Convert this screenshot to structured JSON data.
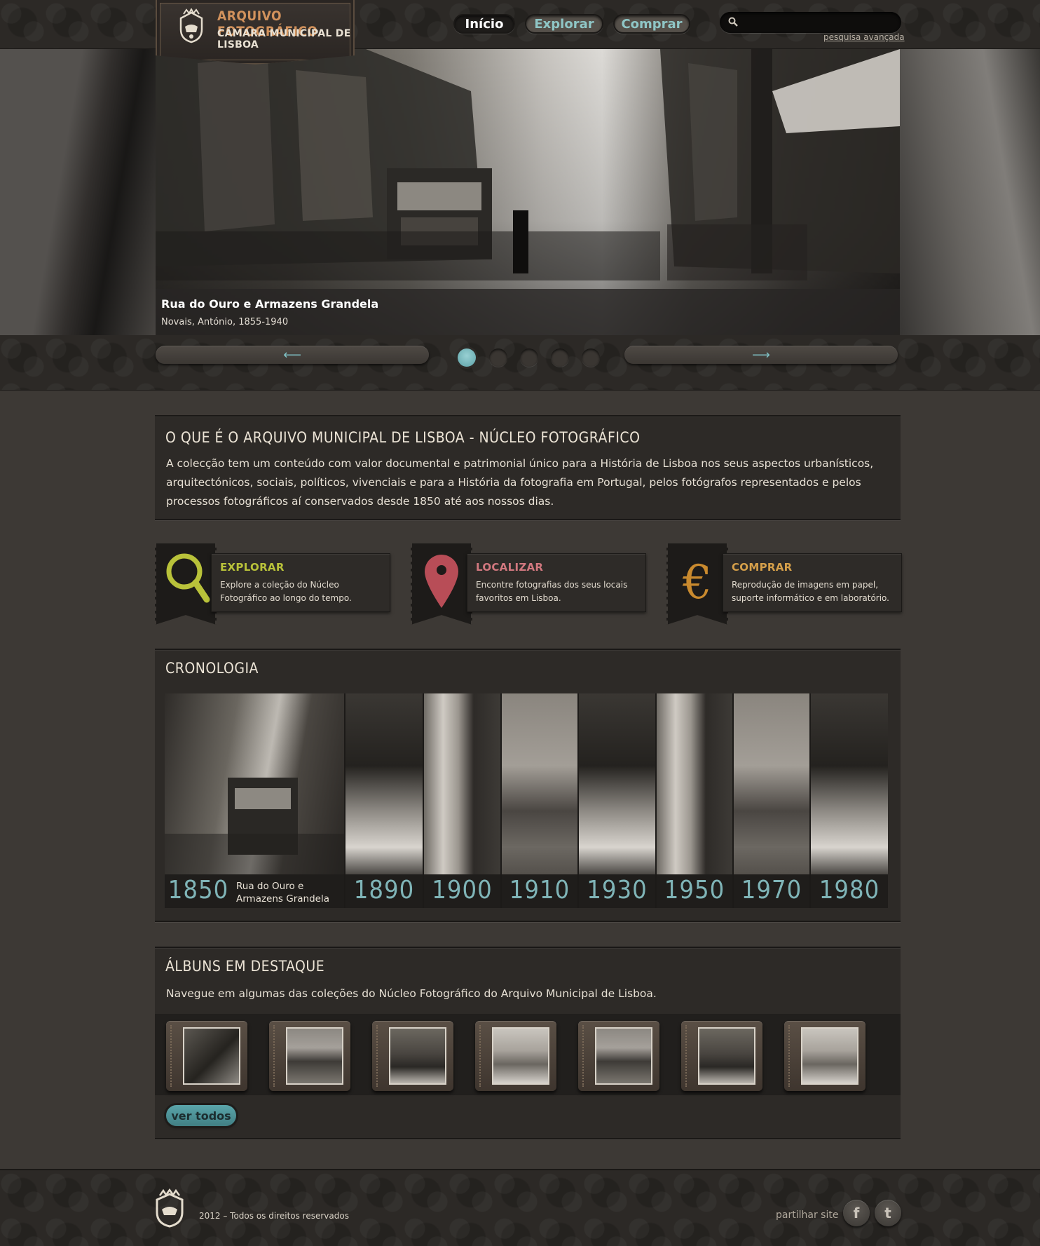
{
  "header": {
    "logo_title": "ARQUIVO FOTOGRÁFICO",
    "logo_subtitle": "CÂMARA MUNICIPAL DE LISBOA",
    "nav": [
      "Início",
      "Explorar",
      "Comprar"
    ],
    "active_nav": "Início",
    "search": {
      "value": "",
      "placeholder": ""
    },
    "advanced_search": "pesquisa avançada"
  },
  "hero": {
    "title": "Rua do Ouro e Armazens Grandela",
    "credit": "Novais, António, 1855-1940",
    "slides_count": 5,
    "active_slide": 1,
    "prev_icon": "arrow-left-icon",
    "next_icon": "arrow-right-icon"
  },
  "about": {
    "title": "O QUE É O ARQUIVO MUNICIPAL DE LISBOA - NÚCLEO FOTOGRÁFICO",
    "text": "A colecção tem um conteúdo com valor documental e patrimonial único para a História de Lisboa nos seus aspectos urbanísticos, arquitectónicos, sociais, políticos, vivenciais e para a História da fotografia em Portugal, pelos fotógrafos representados e pelos processos fotográficos aí conservados desde 1850 até aos nossos dias."
  },
  "features": [
    {
      "title": "EXPLORAR",
      "desc": "Explore a coleção do Núcleo Fotográfico ao longo do tempo.",
      "icon": "magnifier-icon",
      "color": "#b9c23a"
    },
    {
      "title": "LOCALIZAR",
      "desc": "Encontre fotografias dos seus locais favoritos em Lisboa.",
      "icon": "map-pin-icon",
      "color": "#d2787f"
    },
    {
      "title": "COMPRAR",
      "desc": "Reprodução de imagens em papel, suporte informático e em laboratório.",
      "icon": "euro-icon",
      "color": "#d6a04a"
    }
  ],
  "cronologia": {
    "title": "CRONOLOGIA",
    "items": [
      {
        "year": "1850",
        "caption": "Rua do Ouro e Armazens Grandela"
      },
      {
        "year": "1890"
      },
      {
        "year": "1900"
      },
      {
        "year": "1910"
      },
      {
        "year": "1930"
      },
      {
        "year": "1950"
      },
      {
        "year": "1970"
      },
      {
        "year": "1980"
      }
    ]
  },
  "albuns": {
    "title": "ÁLBUNS EM DESTAQUE",
    "desc": "Navegue em algumas das coleções do Núcleo Fotográfico do Arquivo Municipal de Lisboa.",
    "count": 7,
    "view_all": "ver todos"
  },
  "footer": {
    "copyright": "2012 – Todos os direitos reservados",
    "share_label": "partilhar site",
    "social": [
      "f",
      "t"
    ]
  },
  "colors": {
    "accent": "#7fb4b7",
    "background": "#3d3935",
    "panel": "#2d2a27"
  }
}
